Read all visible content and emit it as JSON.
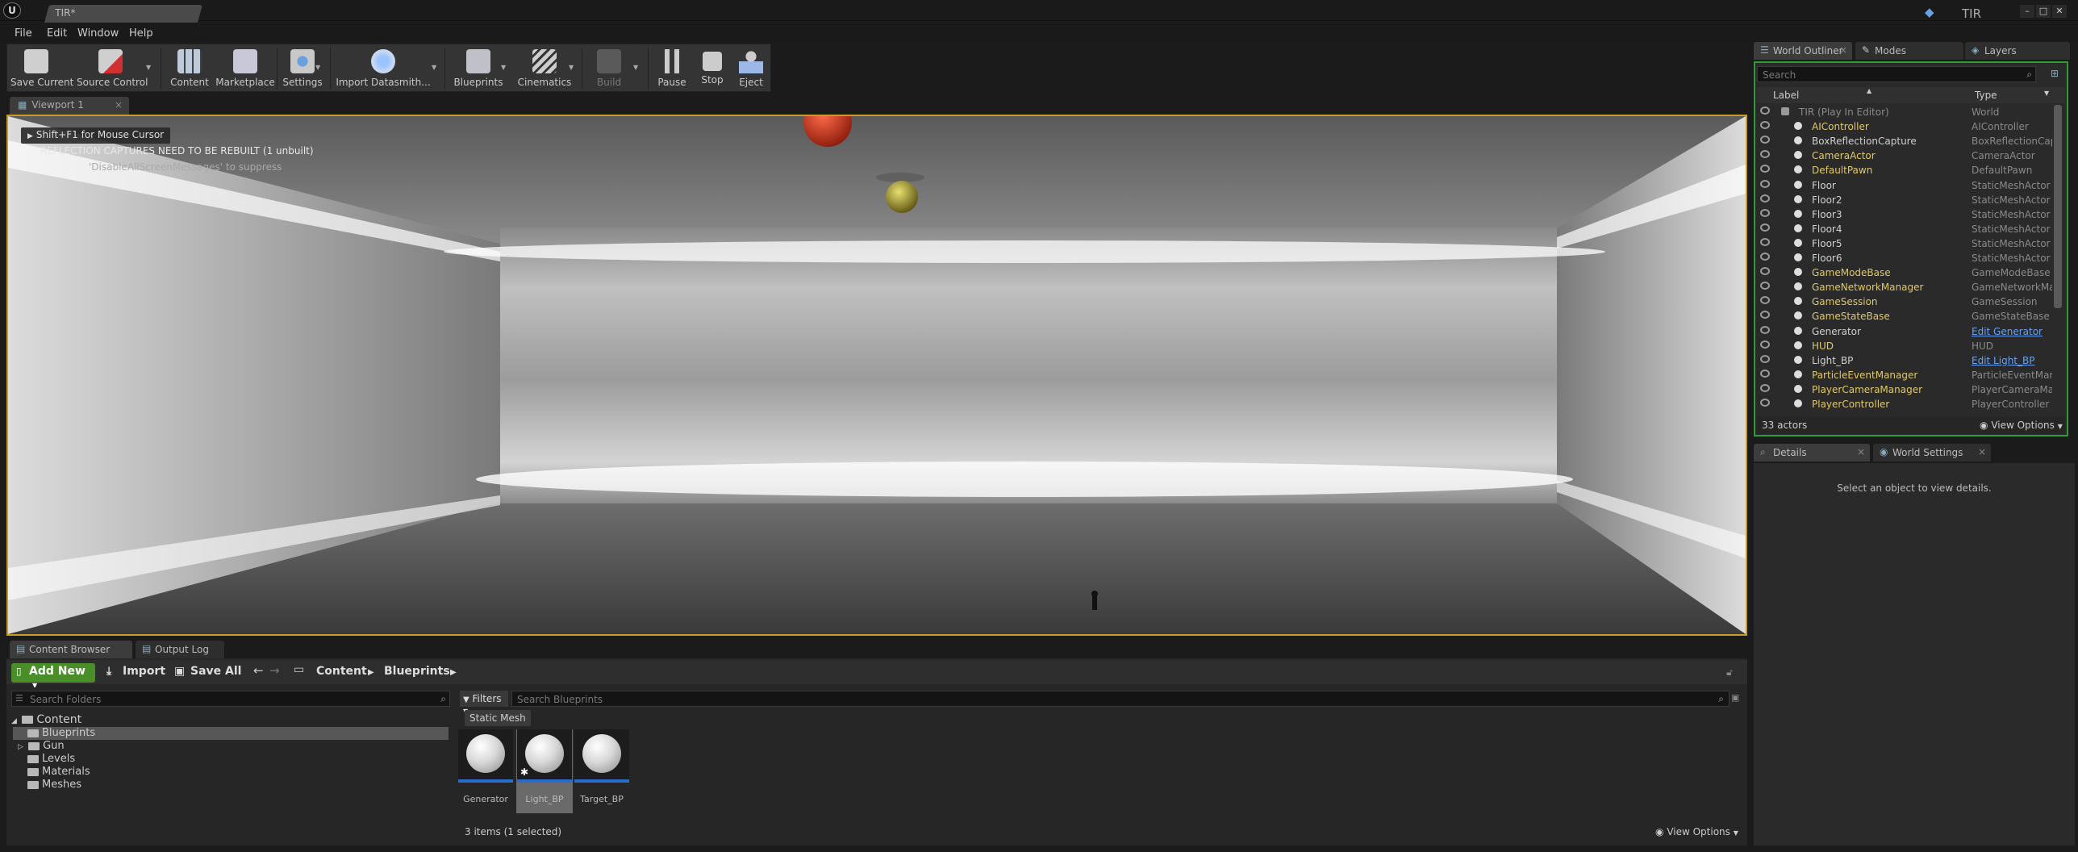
{
  "window": {
    "tab_title": "TIR*",
    "project_name": "TIR"
  },
  "menu": [
    "File",
    "Edit",
    "Window",
    "Help"
  ],
  "toolbar": {
    "save_current": "Save Current",
    "source_control": "Source Control",
    "content": "Content",
    "marketplace": "Marketplace",
    "settings": "Settings",
    "import_datasmith": "Import Datasmith...",
    "blueprints": "Blueprints",
    "cinematics": "Cinematics",
    "build": "Build",
    "pause": "Pause",
    "stop": "Stop",
    "eject": "Eject"
  },
  "viewport": {
    "tab_label": "Viewport 1",
    "mouse_hint": "Shift+F1 for Mouse Cursor",
    "rebuild_message": "REFLECTION CAPTURES NEED TO BE REBUILT (1 unbuilt)",
    "suppress_message": "'DisableAllScreenMessages' to suppress"
  },
  "content_browser": {
    "tab_label": "Content Browser",
    "output_log_label": "Output Log",
    "add_new": "Add New",
    "import": "Import",
    "save_all": "Save All",
    "breadcrumb": [
      "Content",
      "Blueprints"
    ],
    "folder_search_placeholder": "Search Folders",
    "asset_search_placeholder": "Search Blueprints",
    "filters_label": "Filters",
    "filter_chip": "Static Mesh",
    "tree": {
      "root": "Content",
      "children": [
        "Blueprints",
        "Gun",
        "Levels",
        "Materials",
        "Meshes"
      ]
    },
    "assets": [
      {
        "name": "Generator"
      },
      {
        "name": "Light_BP"
      },
      {
        "name": "Target_BP"
      }
    ],
    "items_status": "3 items (1 selected)",
    "view_options": "View Options"
  },
  "outliner": {
    "tab_label": "World Outliner",
    "modes_label": "Modes",
    "layers_label": "Layers",
    "search_placeholder": "Search",
    "col_label": "Label",
    "col_type": "Type",
    "rows": [
      {
        "label": "TIR (Play In Editor)",
        "type": "World",
        "color": "#8a8a8a"
      },
      {
        "label": "AIController",
        "type": "AIController",
        "color": "#e0c86a"
      },
      {
        "label": "BoxReflectionCapture",
        "type": "BoxReflectionCapt",
        "color": "#d0d0d0"
      },
      {
        "label": "CameraActor",
        "type": "CameraActor",
        "color": "#e0c86a"
      },
      {
        "label": "DefaultPawn",
        "type": "DefaultPawn",
        "color": "#e0c86a"
      },
      {
        "label": "Floor",
        "type": "StaticMeshActor",
        "color": "#d0d0d0"
      },
      {
        "label": "Floor2",
        "type": "StaticMeshActor",
        "color": "#d0d0d0"
      },
      {
        "label": "Floor3",
        "type": "StaticMeshActor",
        "color": "#d0d0d0"
      },
      {
        "label": "Floor4",
        "type": "StaticMeshActor",
        "color": "#d0d0d0"
      },
      {
        "label": "Floor5",
        "type": "StaticMeshActor",
        "color": "#d0d0d0"
      },
      {
        "label": "Floor6",
        "type": "StaticMeshActor",
        "color": "#d0d0d0"
      },
      {
        "label": "GameModeBase",
        "type": "GameModeBase",
        "color": "#e0c86a"
      },
      {
        "label": "GameNetworkManager",
        "type": "GameNetworkMan",
        "color": "#e0c86a"
      },
      {
        "label": "GameSession",
        "type": "GameSession",
        "color": "#e0c86a"
      },
      {
        "label": "GameStateBase",
        "type": "GameStateBase",
        "color": "#e0c86a"
      },
      {
        "label": "Generator",
        "type": "Edit Generator",
        "color": "#d0d0d0",
        "link": true
      },
      {
        "label": "HUD",
        "type": "HUD",
        "color": "#e0c86a"
      },
      {
        "label": "Light_BP",
        "type": "Edit Light_BP",
        "color": "#d0d0d0",
        "link": true
      },
      {
        "label": "ParticleEventManager",
        "type": "ParticleEventMana",
        "color": "#e0c86a"
      },
      {
        "label": "PlayerCameraManager",
        "type": "PlayerCameraMan",
        "color": "#e0c86a"
      },
      {
        "label": "PlayerController",
        "type": "PlayerController",
        "color": "#e0c86a"
      }
    ],
    "actor_count": "33 actors",
    "view_options": "View Options"
  },
  "details": {
    "tab_label": "Details",
    "world_settings_label": "World Settings",
    "empty_message": "Select an object to view details."
  },
  "colors": {
    "accent_green": "#4a8e2a",
    "outliner_border": "#2d9c36",
    "viewport_border": "#c89a28",
    "asset_underline": "#2a6cc9"
  }
}
